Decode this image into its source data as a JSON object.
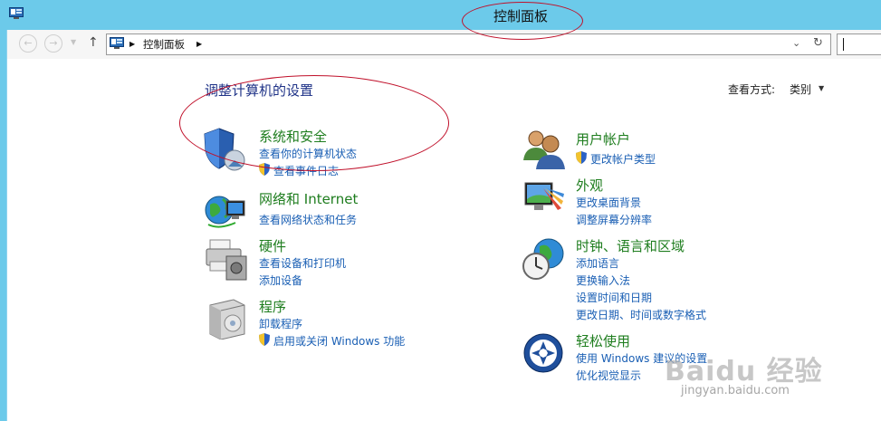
{
  "window": {
    "title": "控制面板"
  },
  "address": {
    "back_icon": "back-arrow-icon",
    "forward_icon": "forward-arrow-icon",
    "up_icon": "up-arrow-icon",
    "breadcrumb": [
      "控制面板"
    ],
    "search_placeholder": ""
  },
  "main": {
    "heading": "调整计算机的设置",
    "view_by_label": "查看方式:",
    "view_by_value": "类别",
    "left_categories": [
      {
        "title": "系统和安全",
        "icon": "system-security-shield-icon",
        "links": [
          {
            "text": "查看你的计算机状态",
            "shield": false
          },
          {
            "text": "查看事件日志",
            "shield": true
          }
        ]
      },
      {
        "title": "网络和 Internet",
        "icon": "network-globe-icon",
        "links": [
          {
            "text": "查看网络状态和任务",
            "shield": false
          }
        ]
      },
      {
        "title": "硬件",
        "icon": "hardware-printer-icon",
        "links": [
          {
            "text": "查看设备和打印机",
            "shield": false
          },
          {
            "text": "添加设备",
            "shield": false
          }
        ]
      },
      {
        "title": "程序",
        "icon": "programs-box-icon",
        "links": [
          {
            "text": "卸载程序",
            "shield": false
          },
          {
            "text": "启用或关闭 Windows 功能",
            "shield": true
          }
        ]
      }
    ],
    "right_categories": [
      {
        "title": "用户帐户",
        "icon": "user-accounts-icon",
        "links": [
          {
            "text": "更改帐户类型",
            "shield": true
          }
        ]
      },
      {
        "title": "外观",
        "icon": "appearance-monitor-icon",
        "links": [
          {
            "text": "更改桌面背景",
            "shield": false
          },
          {
            "text": "调整屏幕分辨率",
            "shield": false
          }
        ]
      },
      {
        "title": "时钟、语言和区域",
        "icon": "clock-globe-icon",
        "links": [
          {
            "text": "添加语言",
            "shield": false
          },
          {
            "text": "更换输入法",
            "shield": false
          },
          {
            "text": "设置时间和日期",
            "shield": false
          },
          {
            "text": "更改日期、时间或数字格式",
            "shield": false
          }
        ]
      },
      {
        "title": "轻松使用",
        "icon": "ease-of-access-icon",
        "links": [
          {
            "text": "使用 Windows 建议的设置",
            "shield": false
          },
          {
            "text": "优化视觉显示",
            "shield": false
          }
        ]
      }
    ]
  },
  "watermark": {
    "text": "Baidu 经验",
    "url_text": "jingyan.baidu.com"
  }
}
